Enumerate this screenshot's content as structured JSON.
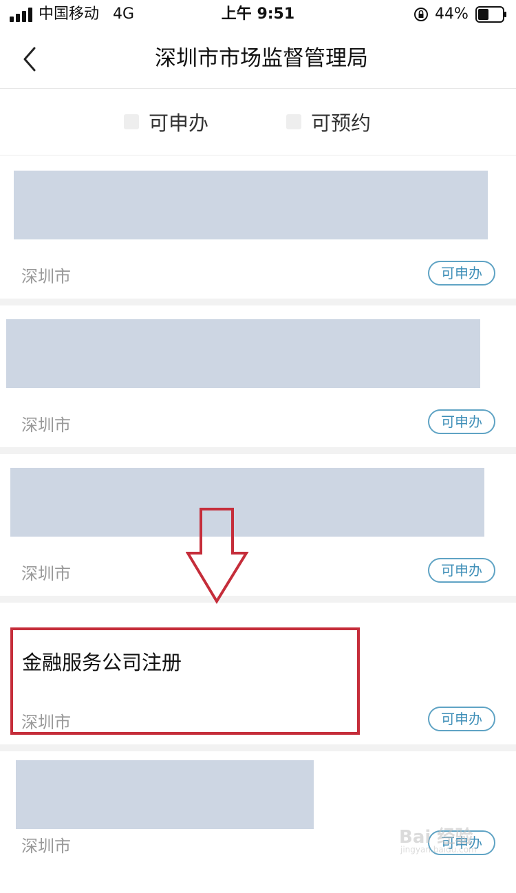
{
  "status_bar": {
    "carrier": "中国移动",
    "network": "4G",
    "time": "上午 9:51",
    "battery_percent": "44%",
    "battery_level": 0.44
  },
  "nav": {
    "title": "深圳市市场监督管理局",
    "back_icon": "chevron-left-icon"
  },
  "filters": [
    {
      "label": "可申办",
      "checked": false
    },
    {
      "label": "可预约",
      "checked": false
    }
  ],
  "services": [
    {
      "title": "",
      "region": "深圳市",
      "status": "可申办",
      "title_redacted": true
    },
    {
      "title": "",
      "region": "深圳市",
      "status": "可申办",
      "title_redacted": true
    },
    {
      "title": "",
      "region": "深圳市",
      "status": "可申办",
      "title_redacted": true
    },
    {
      "title": "金融服务公司注册",
      "region": "深圳市",
      "status": "可申办",
      "title_redacted": false,
      "highlighted": true
    },
    {
      "title": "",
      "region": "深圳市",
      "status": "可申办",
      "title_redacted": true
    }
  ],
  "annotation": {
    "arrow_icon": "down-arrow-icon",
    "color": "#c52d3a"
  },
  "watermark": {
    "text": "Bai 经验",
    "subtext": "jingyan.baidu.com"
  },
  "colors": {
    "redaction": "#cdd6e3",
    "tag_border": "#5fa3c4",
    "region_text": "#999999"
  }
}
